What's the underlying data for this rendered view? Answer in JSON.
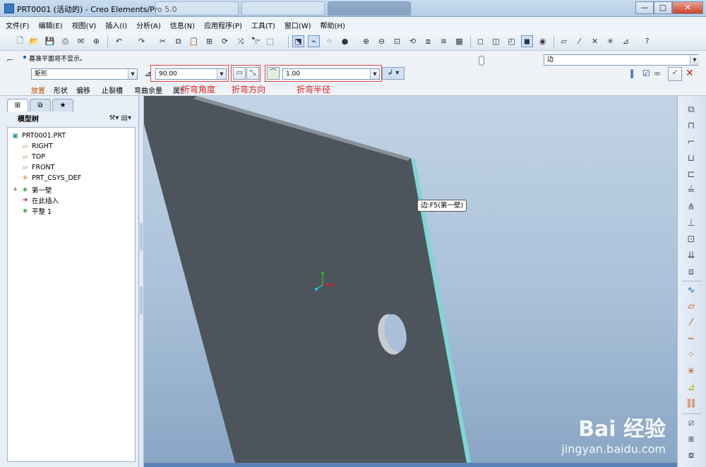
{
  "window": {
    "title": "PRT0001 (活动的) - Creo Elements/Pro 5.0",
    "minimize": "—",
    "maximize": "□",
    "close": "✕"
  },
  "menu": [
    "文件(F)",
    "编辑(E)",
    "视图(V)",
    "插入(I)",
    "分析(A)",
    "信息(N)",
    "应用程序(P)",
    "工具(T)",
    "窗口(W)",
    "帮助(H)"
  ],
  "dashboard": {
    "message": "基准平面将不显示。",
    "shape": "矩形",
    "angle": "90.00",
    "radius": "1.00",
    "reference": "边",
    "tabs": [
      "放置",
      "形状",
      "偏移",
      "止裂槽",
      "弯曲余量",
      "属性"
    ],
    "annotations": {
      "angle": "折弯角度",
      "direction": "折弯方向",
      "radius": "折弯半径"
    },
    "controls": {
      "pause": "‖",
      "preview": "☑",
      "glasses": "∞",
      "ok": "✔",
      "cancel": "✕"
    }
  },
  "model_tree": {
    "tabs": [
      "⊞",
      "⧉",
      "★"
    ],
    "header": "模型树",
    "items": [
      {
        "label": "PRT0001.PRT",
        "icon": "part-icon",
        "glyph": "▣",
        "color": "#2a9aa8",
        "indent": 0
      },
      {
        "label": "RIGHT",
        "icon": "datum-plane-icon",
        "glyph": "▱",
        "color": "#c06020",
        "indent": 1
      },
      {
        "label": "TOP",
        "icon": "datum-plane-icon",
        "glyph": "▱",
        "color": "#c06020",
        "indent": 1
      },
      {
        "label": "FRONT",
        "icon": "datum-plane-icon",
        "glyph": "▱",
        "color": "#c06020",
        "indent": 1
      },
      {
        "label": "PRT_CSYS_DEF",
        "icon": "csys-icon",
        "glyph": "✳",
        "color": "#c06020",
        "indent": 1
      },
      {
        "label": "第一壁",
        "icon": "wall-icon",
        "glyph": "◈",
        "color": "#2f9a2f",
        "indent": 1,
        "expander": "+"
      },
      {
        "label": "在此插入",
        "icon": "insert-here-icon",
        "glyph": "➜",
        "color": "#d01010",
        "indent": 1
      },
      {
        "label": "平整 1",
        "icon": "flat-wall-icon",
        "glyph": "◈",
        "color": "#2f9a2f",
        "indent": 1
      }
    ]
  },
  "viewport": {
    "tooltip": "边:F5(第一壁)"
  },
  "watermark": {
    "logo": "Bai  经验",
    "url": "jingyan.baidu.com"
  }
}
